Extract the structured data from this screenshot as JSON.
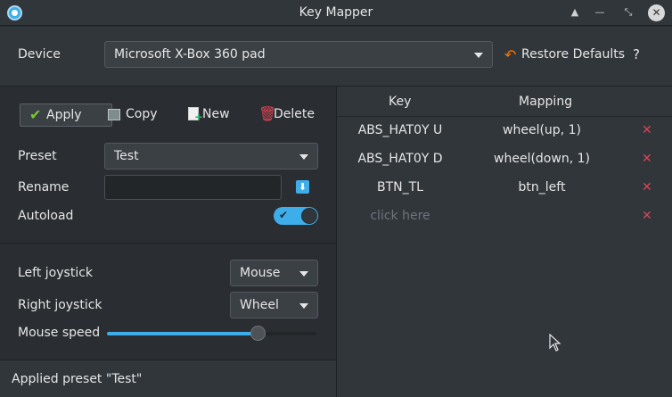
{
  "window": {
    "title": "Key Mapper",
    "minimize_icon": "▲",
    "restore_icon": "⌃",
    "float_icon": "⤡",
    "close_icon": "✕"
  },
  "device": {
    "label": "Device",
    "selected": "Microsoft X-Box 360 pad",
    "restore_label": "Restore Defaults",
    "help_label": "?"
  },
  "toolbar": {
    "apply_label": "Apply",
    "copy_label": "Copy",
    "new_label": "New",
    "delete_label": "Delete"
  },
  "preset": {
    "label": "Preset",
    "selected": "Test"
  },
  "rename": {
    "label": "Rename",
    "value": ""
  },
  "autoload": {
    "label": "Autoload",
    "enabled": true
  },
  "joysticks": {
    "left_label": "Left joystick",
    "left_value": "Mouse",
    "right_label": "Right joystick",
    "right_value": "Wheel",
    "speed_label": "Mouse speed",
    "speed_fraction": 0.72
  },
  "status": {
    "text": "Applied preset \"Test\""
  },
  "table": {
    "headers": {
      "key": "Key",
      "mapping": "Mapping"
    },
    "rows": [
      {
        "key": "ABS_HAT0Y U",
        "mapping": "wheel(up, 1)"
      },
      {
        "key": "ABS_HAT0Y D",
        "mapping": "wheel(down, 1)"
      },
      {
        "key": "BTN_TL",
        "mapping": "btn_left"
      },
      {
        "key": "",
        "placeholder": "click here",
        "mapping": ""
      }
    ],
    "delete_icon": "✕"
  },
  "colors": {
    "accent": "#3daee9",
    "danger": "#da4453",
    "apply_check": "#7cc33a",
    "restore_icon": "#f67400"
  }
}
